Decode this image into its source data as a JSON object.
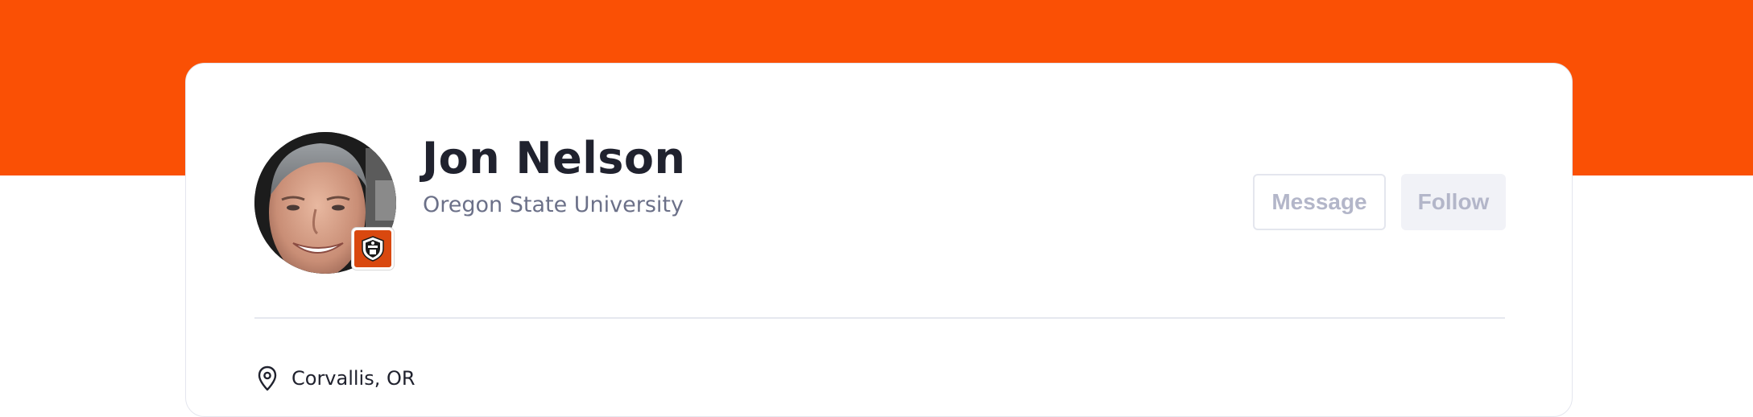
{
  "profile": {
    "name": "Jon Nelson",
    "school": "Oregon State University",
    "location": "Corvallis, OR"
  },
  "actions": {
    "message_label": "Message",
    "follow_label": "Follow"
  },
  "icons": {
    "location": "map-pin-icon",
    "school_logo": "oregon-state-logo",
    "avatar": "profile-photo"
  },
  "colors": {
    "banner": "#fa5005",
    "school_badge": "#d9480f",
    "name_text": "#20222e",
    "secondary_text": "#6b7088",
    "button_text": "#b3b6c9"
  }
}
